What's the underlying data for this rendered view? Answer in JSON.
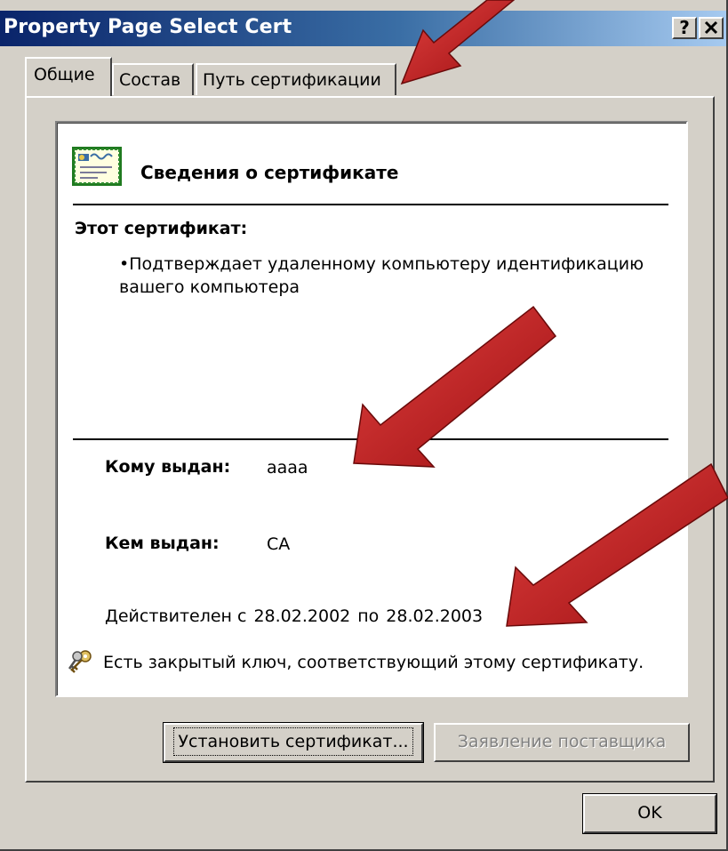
{
  "window": {
    "title": "Property Page Select Cert",
    "help_label": "?",
    "close_label": "✕"
  },
  "tabs": [
    {
      "label": "Общие",
      "active": true
    },
    {
      "label": "Состав",
      "active": false
    },
    {
      "label": "Путь сертификации",
      "active": false
    }
  ],
  "certificate": {
    "heading": "Сведения о сертификате",
    "purpose_label": "Этот сертификат:",
    "purpose_item": "•Подтверждает удаленному компьютеру идентификацию вашего компьютера",
    "issued_to_label": "Кому выдан:",
    "issued_to_value": "aaaa",
    "issued_by_label": "Кем выдан:",
    "issued_by_value": "CA",
    "valid_from_label": "Действителен с",
    "valid_from": "28.02.2002",
    "valid_to_label": "по",
    "valid_to": "28.02.2003",
    "private_key_note": "Есть закрытый ключ, соответствующий этому сертификату."
  },
  "buttons": {
    "install_certificate": "Установить сертификат...",
    "provider_statement": "Заявление поставщика",
    "ok": "OK"
  },
  "colors": {
    "dialog_face": "#d4d0c8",
    "title_gradient_start": "#0a246a",
    "title_gradient_end": "#a6caf0",
    "annotation_arrow": "#c0161b"
  },
  "icons": {
    "certificate": "certificate-icon",
    "private_key": "key-icon",
    "annotation": "red-arrow-annotation"
  }
}
